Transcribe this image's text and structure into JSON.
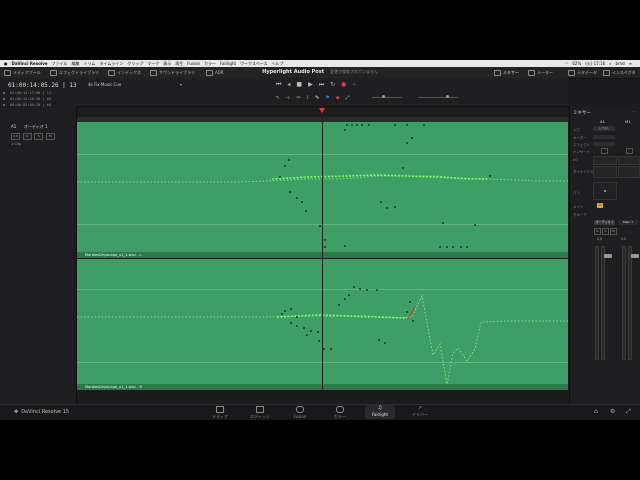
{
  "menubar": {
    "items": [
      "DaVinci Resolve",
      "ファイル",
      "編集",
      "トリム",
      "タイムライン",
      "クリップ",
      "マーク",
      "表示",
      "再生",
      "Fusion",
      "カラー",
      "Fairlight",
      "ワークスペース",
      "ヘルプ"
    ],
    "battery": "62%",
    "clock": "(火) 17:16",
    "user": "brnd"
  },
  "toolbar": {
    "media_pool": "メディアプール",
    "effects_library": "エフェクトライブラリ",
    "index": "インデックス",
    "sound_library": "サウンドライブラリ",
    "adr": "ADR",
    "project_title": "Hyperlight Audio Post",
    "project_status": "変更が保存されていません",
    "mixer": "ミキサー",
    "meters": "メーター",
    "metadata": "メタデータ",
    "inspector": "インスペクタ"
  },
  "timecode": {
    "main": "01:00:14:05.26 | 13",
    "rows": [
      "01:00:12:17:00 | 11",
      "01:00:15:26:48 | 00",
      "00:00:03:09:28 | 00"
    ]
  },
  "timeline_name": "4k Fix Music Cue",
  "track": {
    "id": "A1",
    "name": "オーディオ 1",
    "format": "2.0",
    "buttons": [
      "R",
      "S",
      "M"
    ],
    "clips": "1 Clip"
  },
  "clips": {
    "clip1_name": "MarblesDripscape_v1_1.wav - L",
    "clip2_name": "MarblesDripscape_v1_1.wav - R"
  },
  "mixer": {
    "title": "ミキサー",
    "col_a1": "A1",
    "col_m1": "M1",
    "input_label": "入力",
    "input_value": "入力なし",
    "order_label": "オーダー",
    "effects_label": "エフェクト",
    "insert_label": "インサート",
    "eq_label": "EQ",
    "dynamics_label": "ダイナミクス",
    "pan_label": "パン",
    "main_label": "メイン",
    "main_value": "1",
    "group_label": "グループ",
    "bus_a1": "オーディオ 1",
    "bus_main": "Main 1",
    "db_a1": "0.0",
    "db_main": "0.0"
  },
  "pages": [
    "メディア",
    "エディット",
    "Fusion",
    "カラー",
    "Fairlight",
    "デリバー"
  ],
  "active_page": "Fairlight",
  "brand": "DaVinci Resolve 15",
  "colors": {
    "track_bg": "#3e9e66",
    "automation": "#7bff6a",
    "playhead_marker": "#e0363b"
  }
}
